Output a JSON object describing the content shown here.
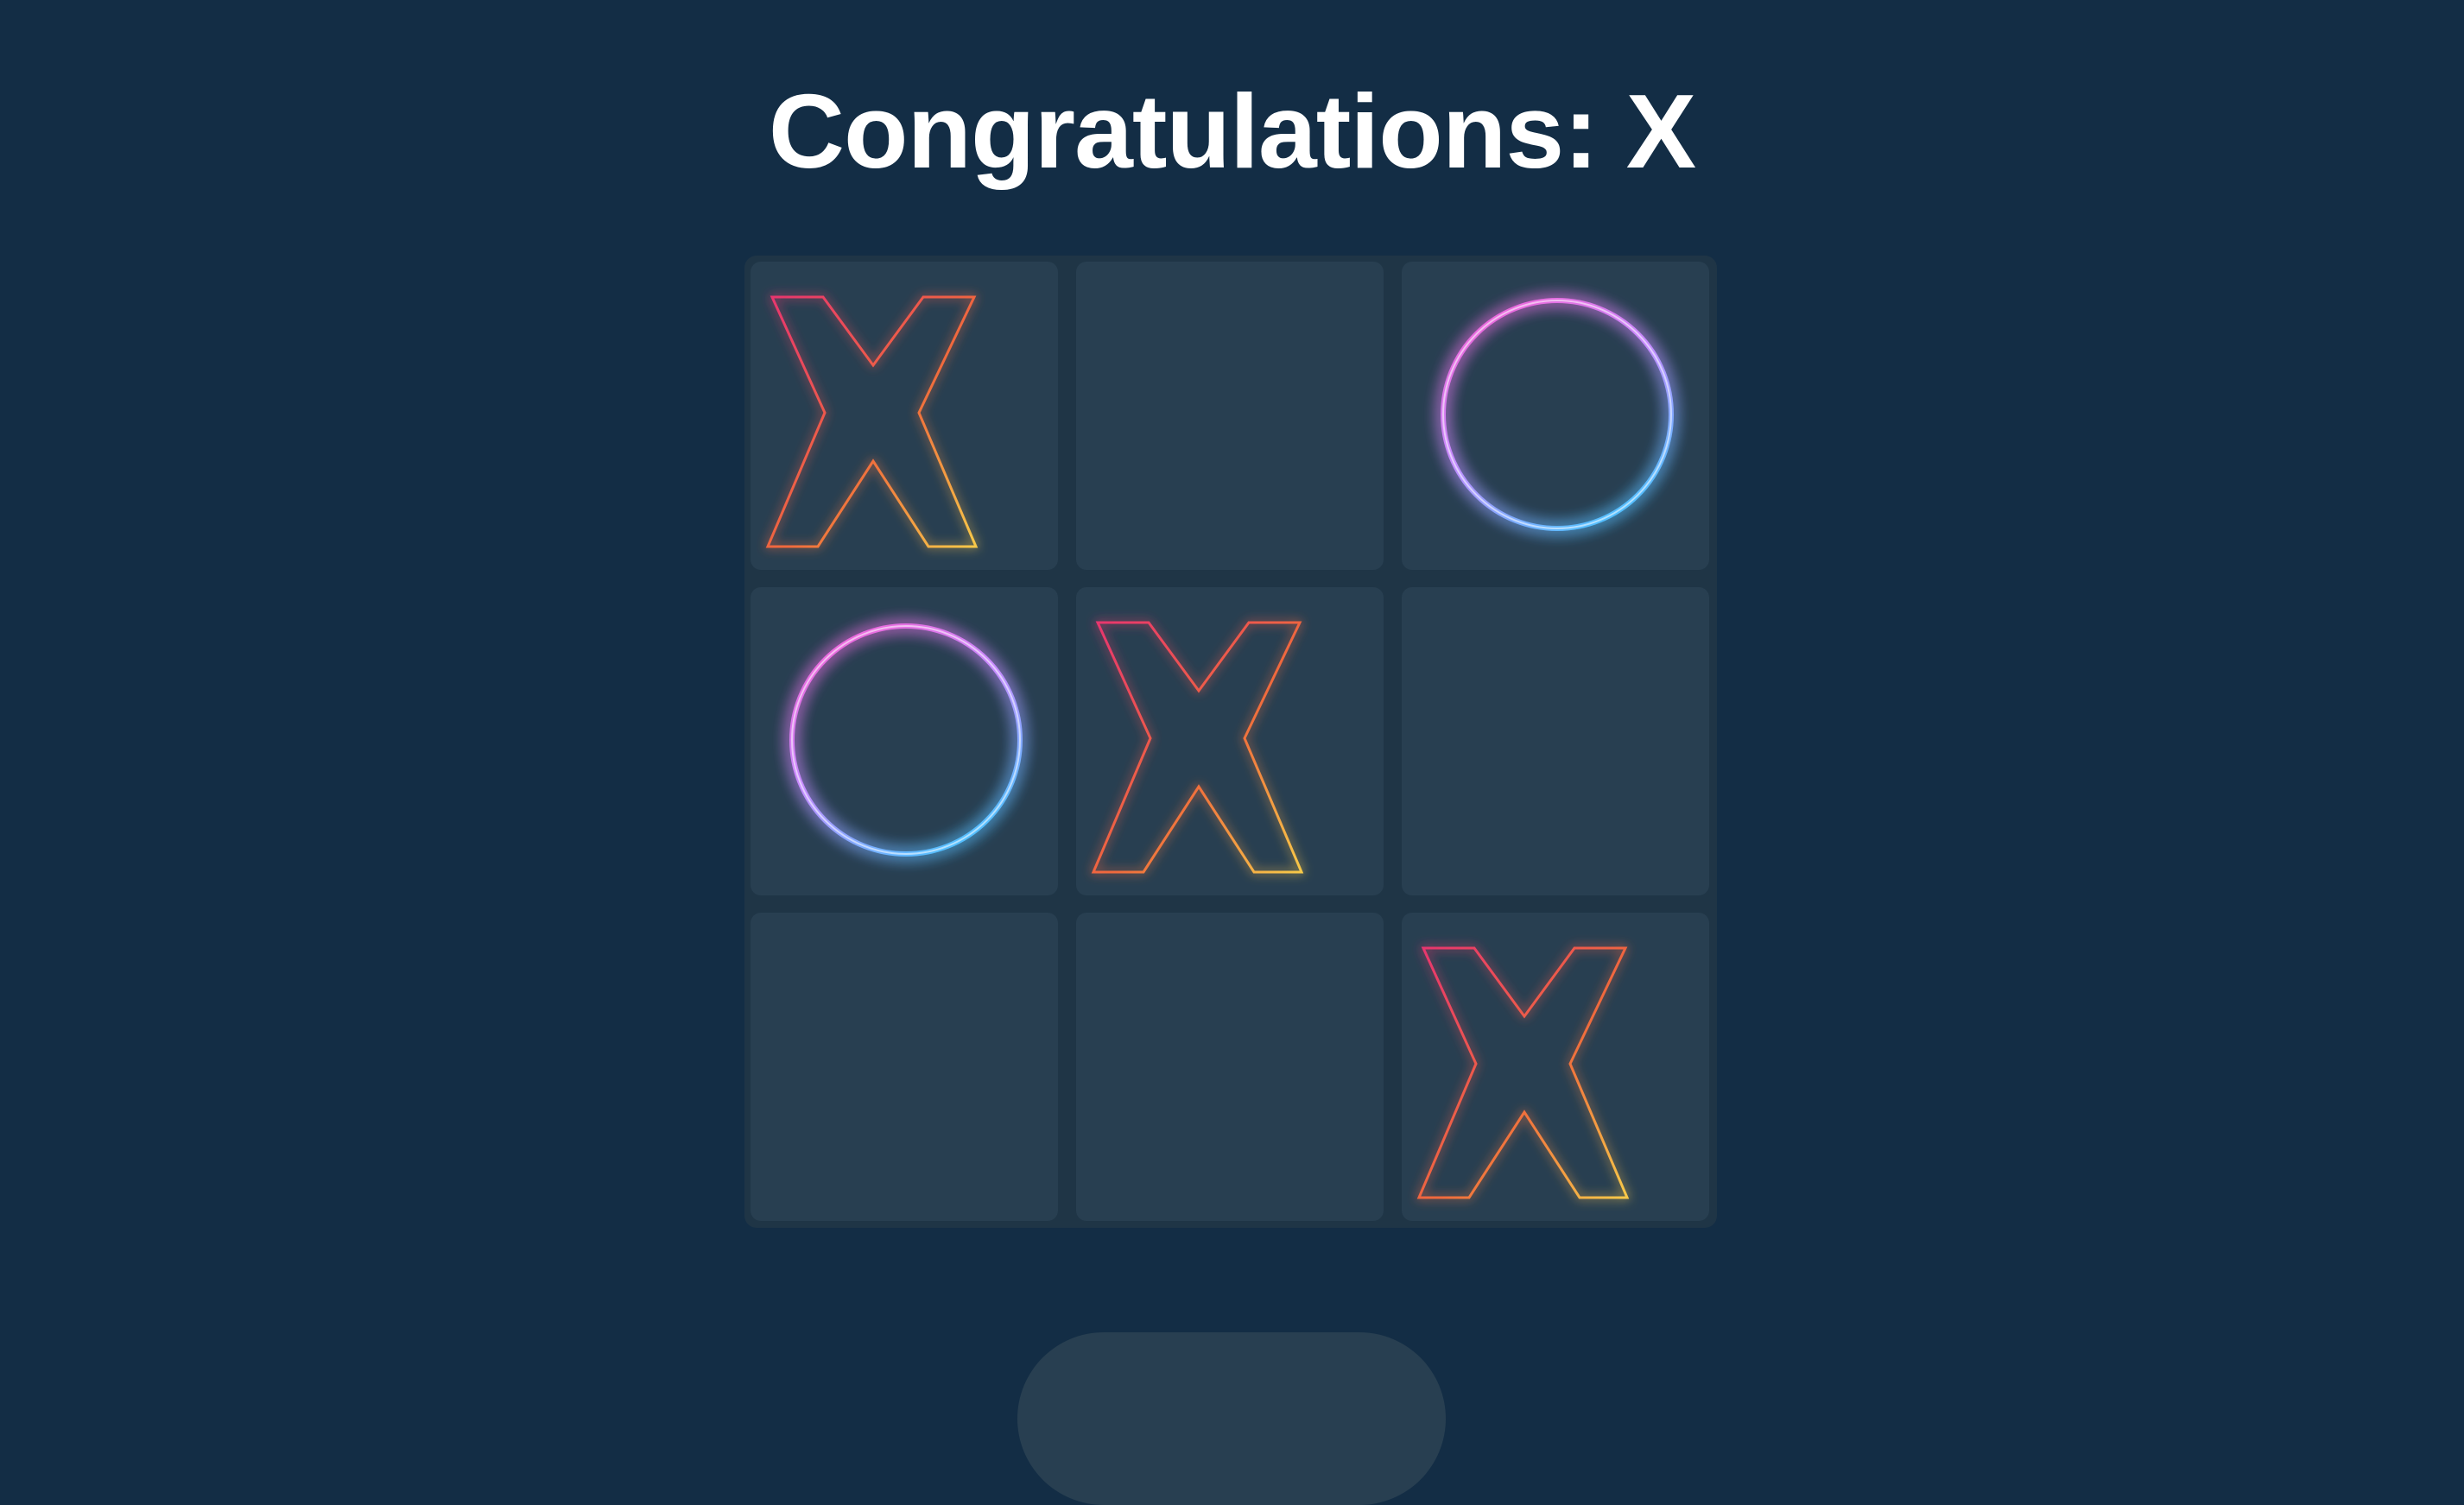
{
  "status": {
    "title": "Congratulations: X"
  },
  "board": {
    "cells": [
      "X",
      "",
      "O",
      "O",
      "X",
      "",
      "",
      "",
      "X"
    ]
  },
  "colors": {
    "background": "#132d45",
    "board": "#1f3546",
    "cell": "#283f51",
    "x_gradient": [
      "#e8356f",
      "#f7c948"
    ],
    "o_gradient": [
      "#e85fd1",
      "#4fc3ff"
    ]
  },
  "icons": {
    "x": "x-mark-icon",
    "o": "o-mark-icon"
  }
}
